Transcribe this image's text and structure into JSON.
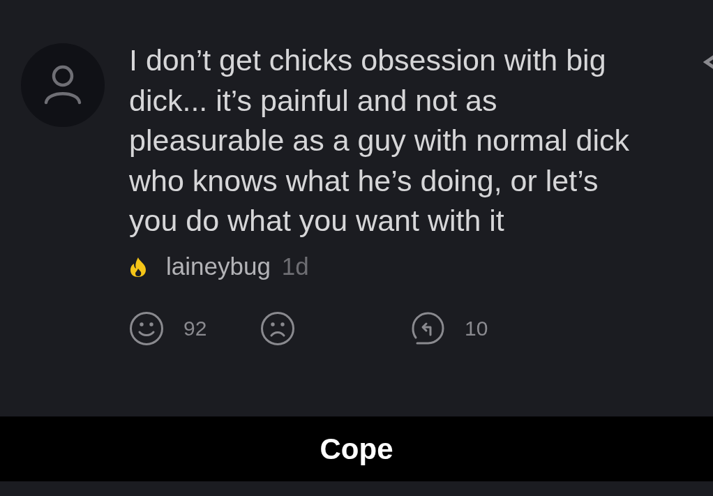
{
  "post": {
    "text": "I don’t get chicks obsession with big dick... it’s painful and not as pleasurable as a guy with normal dick who knows what he’s doing, or let’s you do what you want with it",
    "username": "laineybug",
    "age": "1d",
    "actions": [
      {
        "kind": "upvote",
        "count": "92"
      },
      {
        "kind": "downvote"
      },
      {
        "kind": "reply",
        "count": "10"
      }
    ]
  },
  "caption": "Cope"
}
